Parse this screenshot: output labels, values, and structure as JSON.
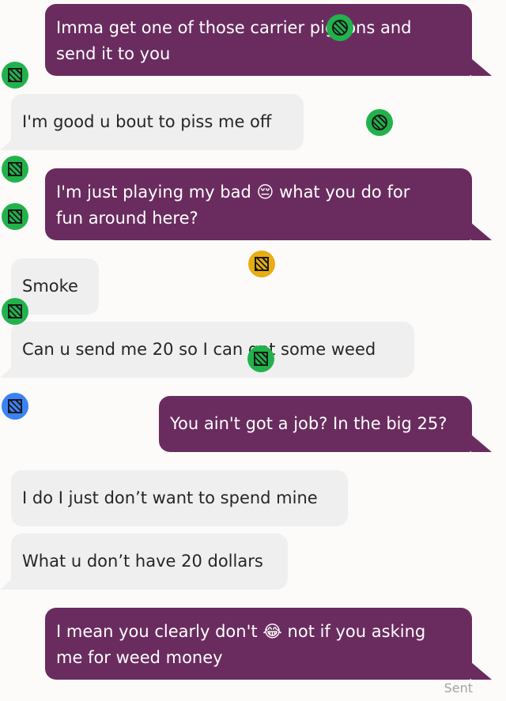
{
  "colors": {
    "outgoing_bubble": "#6a2c5f",
    "incoming_bubble": "#efefef",
    "marker_green": "#22b24c",
    "marker_yellow": "#e7ad12",
    "marker_blue": "#3b82f6"
  },
  "messages": [
    {
      "direction": "outgoing",
      "lines": [
        "Imma get one of those carrier pigeons and",
        "send it to you"
      ]
    },
    {
      "direction": "incoming",
      "lines": [
        "I'm good u bout to piss me off"
      ]
    },
    {
      "direction": "outgoing",
      "lines": [
        "I'm just playing my bad",
        "what you do for",
        "fun around here?"
      ],
      "emoji": "😔"
    },
    {
      "direction": "incoming",
      "lines": [
        "Smoke"
      ]
    },
    {
      "direction": "incoming",
      "lines": [
        "Can u send me 20 so I can get some weed"
      ]
    },
    {
      "direction": "outgoing",
      "lines": [
        "You ain't got a job? In the big 25?"
      ]
    },
    {
      "direction": "incoming",
      "lines": [
        "I do I just don’t want to spend mine"
      ]
    },
    {
      "direction": "incoming",
      "lines": [
        "What u don’t have 20 dollars"
      ]
    },
    {
      "direction": "outgoing",
      "lines": [
        "I mean you clearly don't",
        "not if you asking",
        "me for weed money"
      ],
      "emoji": "😂"
    }
  ],
  "status": "Sent",
  "markers": [
    {
      "color": "green",
      "icon": "circle-icon"
    },
    {
      "color": "green",
      "icon": "square-icon"
    },
    {
      "color": "green",
      "icon": "circle-icon"
    },
    {
      "color": "green",
      "icon": "square-icon"
    },
    {
      "color": "green",
      "icon": "square-icon"
    },
    {
      "color": "yellow",
      "icon": "square-icon"
    },
    {
      "color": "green",
      "icon": "square-icon"
    },
    {
      "color": "green",
      "icon": "square-icon"
    },
    {
      "color": "blue",
      "icon": "square-icon"
    }
  ]
}
